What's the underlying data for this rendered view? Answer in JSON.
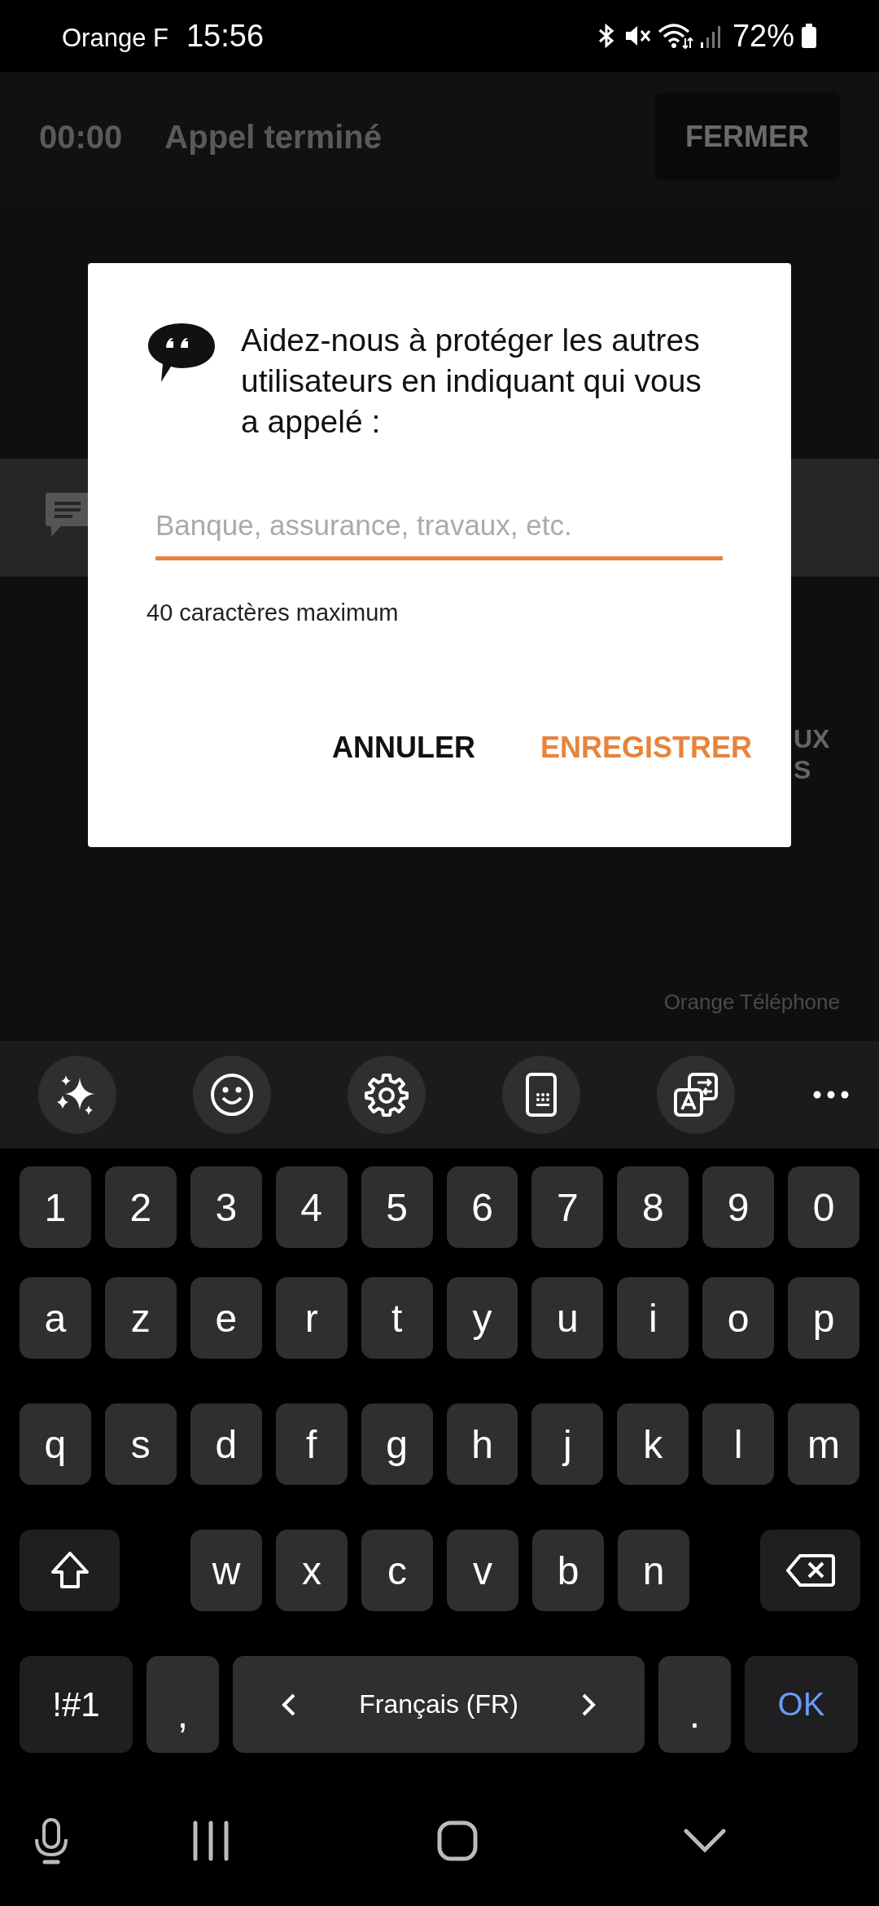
{
  "status_bar": {
    "carrier": "Orange F",
    "time": "15:56",
    "battery": "72%"
  },
  "call_screen": {
    "duration": "00:00",
    "status": "Appel terminé",
    "close_button": "FERMER",
    "cut_labels": [
      "UX",
      "S"
    ],
    "footer": "Orange Téléphone"
  },
  "dialog": {
    "message": "Aidez-nous à protéger les autres utilisateurs en indiquant qui vous a appelé :",
    "input": {
      "placeholder": "Banque, assurance, travaux, etc."
    },
    "helper": "40 caractères maximum",
    "buttons": [
      {
        "label": "ANNULER",
        "kind": "neutral"
      },
      {
        "label": "ENREGISTRER",
        "kind": "primary"
      }
    ]
  },
  "keyboard": {
    "rows": [
      {
        "keys": [
          {
            "label": "1",
            "kind": "char"
          },
          {
            "label": "2",
            "kind": "char"
          },
          {
            "label": "3",
            "kind": "char"
          },
          {
            "label": "4",
            "kind": "char"
          },
          {
            "label": "5",
            "kind": "char"
          },
          {
            "label": "6",
            "kind": "char"
          },
          {
            "label": "7",
            "kind": "char"
          },
          {
            "label": "8",
            "kind": "char"
          },
          {
            "label": "9",
            "kind": "char"
          },
          {
            "label": "0",
            "kind": "char"
          }
        ]
      },
      {
        "keys": [
          {
            "label": "a",
            "kind": "char"
          },
          {
            "label": "z",
            "kind": "char"
          },
          {
            "label": "e",
            "kind": "char"
          },
          {
            "label": "r",
            "kind": "char"
          },
          {
            "label": "t",
            "kind": "char"
          },
          {
            "label": "y",
            "kind": "char"
          },
          {
            "label": "u",
            "kind": "char"
          },
          {
            "label": "i",
            "kind": "char"
          },
          {
            "label": "o",
            "kind": "char"
          },
          {
            "label": "p",
            "kind": "char"
          }
        ]
      },
      {
        "keys": [
          {
            "label": "q",
            "kind": "char"
          },
          {
            "label": "s",
            "kind": "char"
          },
          {
            "label": "d",
            "kind": "char"
          },
          {
            "label": "f",
            "kind": "char"
          },
          {
            "label": "g",
            "kind": "char"
          },
          {
            "label": "h",
            "kind": "char"
          },
          {
            "label": "j",
            "kind": "char"
          },
          {
            "label": "k",
            "kind": "char"
          },
          {
            "label": "l",
            "kind": "char"
          },
          {
            "label": "m",
            "kind": "char"
          }
        ]
      },
      {
        "keys": [
          {
            "kind": "shift"
          },
          {
            "label": "w",
            "kind": "char"
          },
          {
            "label": "x",
            "kind": "char"
          },
          {
            "label": "c",
            "kind": "char"
          },
          {
            "label": "v",
            "kind": "char"
          },
          {
            "label": "b",
            "kind": "char"
          },
          {
            "label": "n",
            "kind": "char"
          },
          {
            "kind": "backspace"
          }
        ]
      },
      {
        "keys": [
          {
            "label": "!#1",
            "kind": "symbols"
          },
          {
            "label": ",",
            "kind": "punct"
          },
          {
            "label": "Français (FR)",
            "kind": "space"
          },
          {
            "label": ".",
            "kind": "punct"
          },
          {
            "label": "OK",
            "kind": "action"
          }
        ]
      }
    ]
  }
}
